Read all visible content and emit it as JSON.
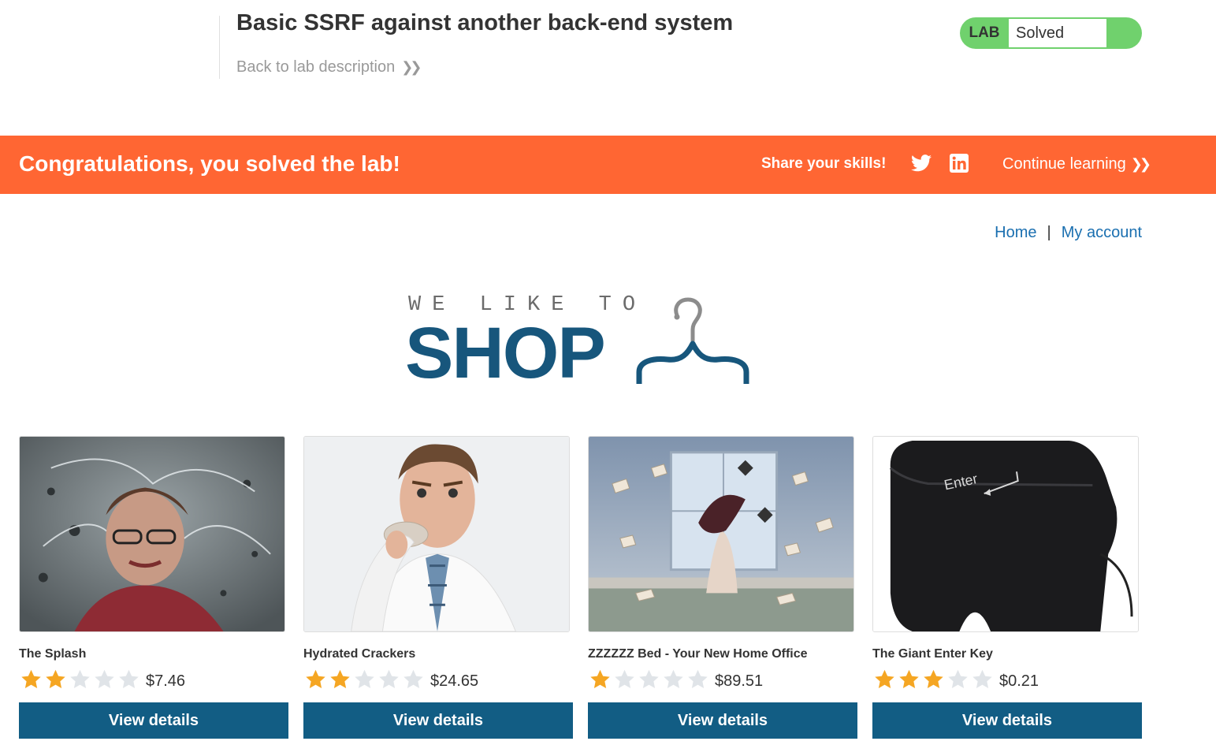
{
  "lab": {
    "title": "Basic SSRF against another back-end system",
    "back_link": "Back to lab description",
    "status_tag": "LAB",
    "status": "Solved"
  },
  "banner": {
    "message": "Congratulations, you solved the lab!",
    "share": "Share your skills!",
    "twitter_icon": "twitter-icon",
    "linkedin_icon": "linkedin-icon",
    "continue": "Continue learning"
  },
  "nav": {
    "home": "Home",
    "separator": "|",
    "account": "My account"
  },
  "logo": {
    "line1": "WE LIKE TO",
    "line2": "SHOP",
    "icon": "hanger-icon"
  },
  "colors": {
    "banner": "#ff6633",
    "status_green": "#70d16d",
    "button_blue": "#125d84",
    "link_blue": "#1a6fb0",
    "star_filled": "#f5a623",
    "star_empty": "#e0e4e8"
  },
  "products": [
    {
      "name": "The Splash",
      "rating": 2,
      "max_rating": 5,
      "price": "$7.46",
      "button": "View details"
    },
    {
      "name": "Hydrated Crackers",
      "rating": 2,
      "max_rating": 5,
      "price": "$24.65",
      "button": "View details"
    },
    {
      "name": "ZZZZZZ Bed - Your New Home Office",
      "rating": 1,
      "max_rating": 5,
      "price": "$89.51",
      "button": "View details"
    },
    {
      "name": "The Giant Enter Key",
      "rating": 3,
      "max_rating": 5,
      "price": "$0.21",
      "button": "View details",
      "image_text": "Enter"
    }
  ]
}
